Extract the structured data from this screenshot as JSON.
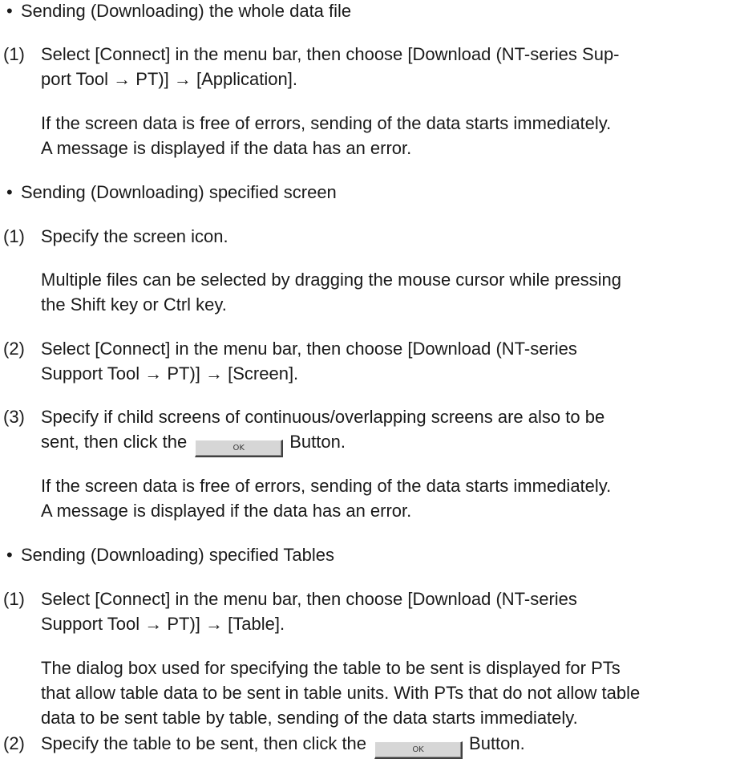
{
  "sections": [
    {
      "bullet": "•",
      "heading": "Sending (Downloading) the whole data file",
      "steps": [
        {
          "num": "(1)",
          "lines": [
            "Select [Connect] in the menu bar, then choose [Download (NT-series Sup-",
            "port Tool → PT)] → [Application]."
          ],
          "notes": [
            "If the screen data is free of errors, sending of the data starts immediately.",
            "A message is displayed if the data has an error."
          ]
        }
      ]
    },
    {
      "bullet": "•",
      "heading": "Sending (Downloading) specified screen",
      "steps": [
        {
          "num": "(1)",
          "lines": [
            "Specify the screen icon."
          ],
          "notes": [
            "Multiple files can be selected by dragging the mouse cursor while pressing",
            "the Shift key or Ctrl key."
          ]
        },
        {
          "num": "(2)",
          "lines": [
            "Select [Connect] in the menu bar, then choose [Download (NT-series",
            "Support Tool → PT)] → [Screen]."
          ]
        },
        {
          "num": "(3)",
          "lines": [
            "Specify if child screens of continuous/overlapping screens are also to be"
          ],
          "button_line": {
            "before": "sent, then click the",
            "after": "Button."
          },
          "notes": [
            "If the screen data is free of errors, sending of the data starts immediately.",
            "A message is displayed if the data has an error."
          ]
        }
      ]
    },
    {
      "bullet": "•",
      "heading": "Sending (Downloading) specified Tables",
      "steps": [
        {
          "num": "(1)",
          "lines": [
            "Select [Connect] in the menu bar, then choose [Download (NT-series",
            "Support Tool → PT)] → [Table]."
          ],
          "notes": [
            "The dialog box used for specifying the table to be sent is displayed for PTs",
            "that allow table data to be sent in table units. With PTs that do not allow table",
            "data to be sent table by table, sending of the data starts immediately."
          ]
        },
        {
          "num": "(2)",
          "button_line": {
            "before": "Specify the table to be sent, then click the",
            "after": "Button."
          }
        }
      ]
    }
  ],
  "ok_button_label": "OK"
}
